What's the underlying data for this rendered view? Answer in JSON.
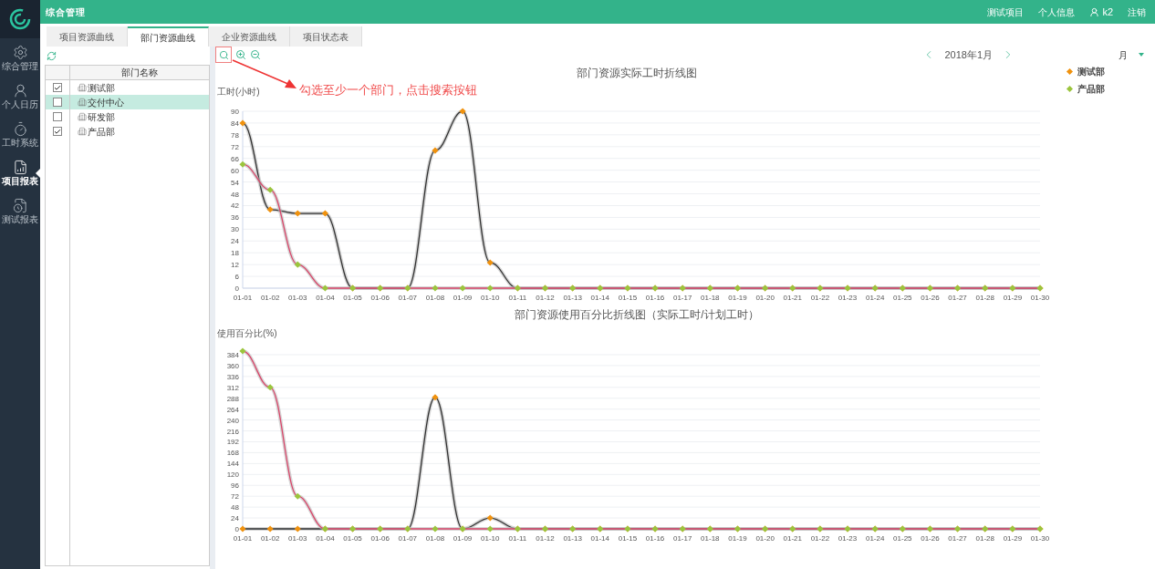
{
  "topbar": {
    "title": "综合管理",
    "links": [
      "测试项目",
      "个人信息"
    ],
    "user": "k2",
    "logout": "注销"
  },
  "sidebar": {
    "items": [
      {
        "label": "综合管理",
        "selected": false
      },
      {
        "label": "个人日历",
        "selected": false
      },
      {
        "label": "工时系统",
        "selected": false
      },
      {
        "label": "项目报表",
        "selected": true
      },
      {
        "label": "测试报表",
        "selected": false
      }
    ]
  },
  "tabs": [
    {
      "label": "项目资源曲线",
      "selected": false
    },
    {
      "label": "部门资源曲线",
      "selected": true
    },
    {
      "label": "企业资源曲线",
      "selected": false
    },
    {
      "label": "项目状态表",
      "selected": false
    }
  ],
  "department_table": {
    "header": "部门名称",
    "rows": [
      {
        "name": "测试部",
        "checked": true,
        "selected": false
      },
      {
        "name": "交付中心",
        "checked": false,
        "selected": true
      },
      {
        "name": "研发部",
        "checked": false,
        "selected": false
      },
      {
        "name": "产品部",
        "checked": true,
        "selected": false
      }
    ]
  },
  "hint": "勾选至少一个部门，点击搜索按钮",
  "period": {
    "label": "2018年1月",
    "unit": "月"
  },
  "charts": [
    {
      "chart_data": {
        "type": "line",
        "title": "部门资源实际工时折线图",
        "ylabel": "工时(小时)",
        "grid": true,
        "categories": [
          "01-01",
          "01-02",
          "01-03",
          "01-04",
          "01-05",
          "01-06",
          "01-07",
          "01-08",
          "01-09",
          "01-10",
          "01-11",
          "01-12",
          "01-13",
          "01-14",
          "01-15",
          "01-16",
          "01-17",
          "01-18",
          "01-19",
          "01-20",
          "01-21",
          "01-22",
          "01-23",
          "01-24",
          "01-25",
          "01-26",
          "01-27",
          "01-28",
          "01-29",
          "01-30"
        ],
        "ylim": [
          0,
          90
        ],
        "yticks": [
          0,
          6,
          12,
          18,
          24,
          30,
          36,
          42,
          48,
          54,
          60,
          66,
          72,
          78,
          84,
          90
        ],
        "series": [
          {
            "name": "测试部",
            "color": "#f0920e",
            "marker": "diamond",
            "values": [
              84,
              40,
              38,
              38,
              0,
              0,
              0,
              70,
              90,
              13,
              0,
              0,
              0,
              0,
              0,
              0,
              0,
              0,
              0,
              0,
              0,
              0,
              0,
              0,
              0,
              0,
              0,
              0,
              0,
              0
            ]
          },
          {
            "name": "产品部",
            "color": "#9bc53d",
            "marker": "diamond",
            "values": [
              63,
              50,
              12,
              0,
              0,
              0,
              0,
              0,
              0,
              0,
              0,
              0,
              0,
              0,
              0,
              0,
              0,
              0,
              0,
              0,
              0,
              0,
              0,
              0,
              0,
              0,
              0,
              0,
              0,
              0
            ]
          }
        ]
      }
    },
    {
      "chart_data": {
        "type": "line",
        "title": "部门资源使用百分比折线图（实际工时/计划工时）",
        "ylabel": "使用百分比(%)",
        "grid": true,
        "categories": [
          "01-01",
          "01-02",
          "01-03",
          "01-04",
          "01-05",
          "01-06",
          "01-07",
          "01-08",
          "01-09",
          "01-10",
          "01-11",
          "01-12",
          "01-13",
          "01-14",
          "01-15",
          "01-16",
          "01-17",
          "01-18",
          "01-19",
          "01-20",
          "01-21",
          "01-22",
          "01-23",
          "01-24",
          "01-25",
          "01-26",
          "01-27",
          "01-28",
          "01-29",
          "01-30"
        ],
        "ylim": [
          0,
          396
        ],
        "yticks": [
          0,
          24,
          48,
          72,
          96,
          120,
          144,
          168,
          192,
          216,
          240,
          264,
          288,
          312,
          336,
          360,
          384
        ],
        "series": [
          {
            "color": "#f0920e",
            "marker": "diamond",
            "values": [
              0,
              0,
              0,
              0,
              0,
              0,
              0,
              290,
              0,
              24,
              0,
              0,
              0,
              0,
              0,
              0,
              0,
              0,
              0,
              0,
              0,
              0,
              0,
              0,
              0,
              0,
              0,
              0,
              0,
              0
            ]
          },
          {
            "color": "#9bc53d",
            "marker": "diamond",
            "values": [
              392,
              312,
              72,
              0,
              0,
              0,
              0,
              0,
              0,
              0,
              0,
              0,
              0,
              0,
              0,
              0,
              0,
              0,
              0,
              0,
              0,
              0,
              0,
              0,
              0,
              0,
              0,
              0,
              0,
              0
            ]
          }
        ]
      }
    }
  ]
}
